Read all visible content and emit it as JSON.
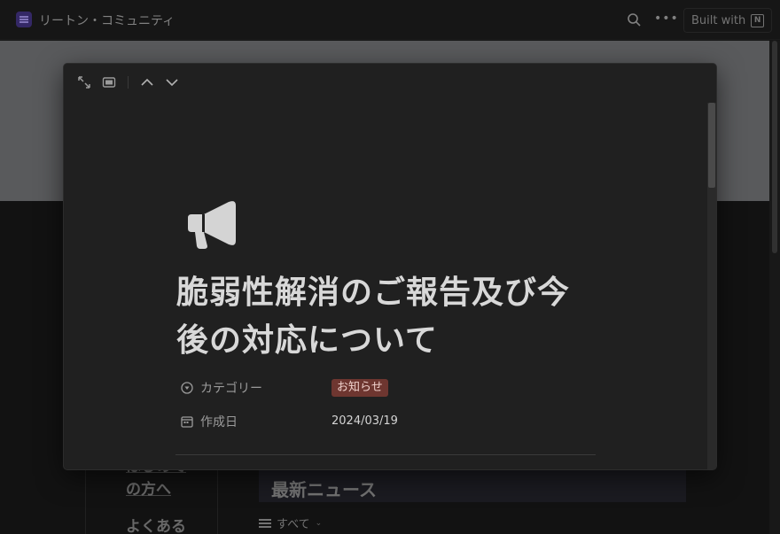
{
  "topbar": {
    "workspace_title": "リートン・コミュニティ",
    "more_label": "•••",
    "built_with_label": "Built with",
    "notion_logo": "N"
  },
  "background": {
    "nav_item_1": "はじめての方へ",
    "nav_item_2": "よくある",
    "news_heading": "最新ニュース",
    "filter_label": "すべて"
  },
  "modal": {
    "tools": [
      "expand-icon",
      "peek-mode-icon",
      "chevron-up-icon",
      "chevron-down-icon"
    ],
    "page_icon": "megaphone-icon",
    "title": "脆弱性解消のご報告及び今後の対応について",
    "properties": [
      {
        "label": "カテゴリー",
        "icon": "select-icon",
        "value": "お知らせ"
      },
      {
        "label": "作成日",
        "icon": "calendar-icon",
        "value": "2024/03/19"
      }
    ]
  },
  "colors": {
    "background": "#191919",
    "modal": "#202020",
    "tag_bg": "#6e3630",
    "tag_text": "#f0d2cd",
    "workspace_icon": "#3e2f7a"
  }
}
